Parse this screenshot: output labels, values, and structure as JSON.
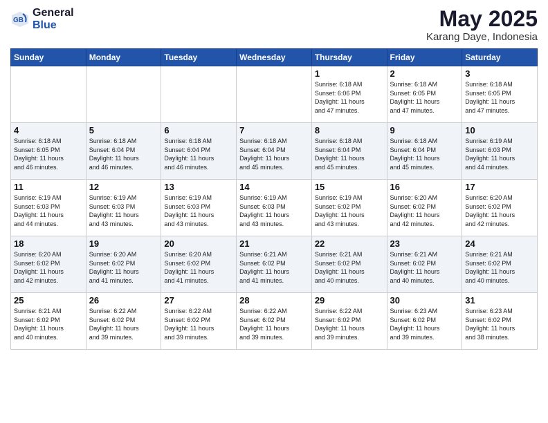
{
  "header": {
    "logo_general": "General",
    "logo_blue": "Blue",
    "month_year": "May 2025",
    "location": "Karang Daye, Indonesia"
  },
  "days_of_week": [
    "Sunday",
    "Monday",
    "Tuesday",
    "Wednesday",
    "Thursday",
    "Friday",
    "Saturday"
  ],
  "weeks": [
    [
      {
        "day": "",
        "content": ""
      },
      {
        "day": "",
        "content": ""
      },
      {
        "day": "",
        "content": ""
      },
      {
        "day": "",
        "content": ""
      },
      {
        "day": "1",
        "content": "Sunrise: 6:18 AM\nSunset: 6:06 PM\nDaylight: 11 hours\nand 47 minutes."
      },
      {
        "day": "2",
        "content": "Sunrise: 6:18 AM\nSunset: 6:05 PM\nDaylight: 11 hours\nand 47 minutes."
      },
      {
        "day": "3",
        "content": "Sunrise: 6:18 AM\nSunset: 6:05 PM\nDaylight: 11 hours\nand 47 minutes."
      }
    ],
    [
      {
        "day": "4",
        "content": "Sunrise: 6:18 AM\nSunset: 6:05 PM\nDaylight: 11 hours\nand 46 minutes."
      },
      {
        "day": "5",
        "content": "Sunrise: 6:18 AM\nSunset: 6:04 PM\nDaylight: 11 hours\nand 46 minutes."
      },
      {
        "day": "6",
        "content": "Sunrise: 6:18 AM\nSunset: 6:04 PM\nDaylight: 11 hours\nand 46 minutes."
      },
      {
        "day": "7",
        "content": "Sunrise: 6:18 AM\nSunset: 6:04 PM\nDaylight: 11 hours\nand 45 minutes."
      },
      {
        "day": "8",
        "content": "Sunrise: 6:18 AM\nSunset: 6:04 PM\nDaylight: 11 hours\nand 45 minutes."
      },
      {
        "day": "9",
        "content": "Sunrise: 6:18 AM\nSunset: 6:04 PM\nDaylight: 11 hours\nand 45 minutes."
      },
      {
        "day": "10",
        "content": "Sunrise: 6:19 AM\nSunset: 6:03 PM\nDaylight: 11 hours\nand 44 minutes."
      }
    ],
    [
      {
        "day": "11",
        "content": "Sunrise: 6:19 AM\nSunset: 6:03 PM\nDaylight: 11 hours\nand 44 minutes."
      },
      {
        "day": "12",
        "content": "Sunrise: 6:19 AM\nSunset: 6:03 PM\nDaylight: 11 hours\nand 43 minutes."
      },
      {
        "day": "13",
        "content": "Sunrise: 6:19 AM\nSunset: 6:03 PM\nDaylight: 11 hours\nand 43 minutes."
      },
      {
        "day": "14",
        "content": "Sunrise: 6:19 AM\nSunset: 6:03 PM\nDaylight: 11 hours\nand 43 minutes."
      },
      {
        "day": "15",
        "content": "Sunrise: 6:19 AM\nSunset: 6:02 PM\nDaylight: 11 hours\nand 43 minutes."
      },
      {
        "day": "16",
        "content": "Sunrise: 6:20 AM\nSunset: 6:02 PM\nDaylight: 11 hours\nand 42 minutes."
      },
      {
        "day": "17",
        "content": "Sunrise: 6:20 AM\nSunset: 6:02 PM\nDaylight: 11 hours\nand 42 minutes."
      }
    ],
    [
      {
        "day": "18",
        "content": "Sunrise: 6:20 AM\nSunset: 6:02 PM\nDaylight: 11 hours\nand 42 minutes."
      },
      {
        "day": "19",
        "content": "Sunrise: 6:20 AM\nSunset: 6:02 PM\nDaylight: 11 hours\nand 41 minutes."
      },
      {
        "day": "20",
        "content": "Sunrise: 6:20 AM\nSunset: 6:02 PM\nDaylight: 11 hours\nand 41 minutes."
      },
      {
        "day": "21",
        "content": "Sunrise: 6:21 AM\nSunset: 6:02 PM\nDaylight: 11 hours\nand 41 minutes."
      },
      {
        "day": "22",
        "content": "Sunrise: 6:21 AM\nSunset: 6:02 PM\nDaylight: 11 hours\nand 40 minutes."
      },
      {
        "day": "23",
        "content": "Sunrise: 6:21 AM\nSunset: 6:02 PM\nDaylight: 11 hours\nand 40 minutes."
      },
      {
        "day": "24",
        "content": "Sunrise: 6:21 AM\nSunset: 6:02 PM\nDaylight: 11 hours\nand 40 minutes."
      }
    ],
    [
      {
        "day": "25",
        "content": "Sunrise: 6:21 AM\nSunset: 6:02 PM\nDaylight: 11 hours\nand 40 minutes."
      },
      {
        "day": "26",
        "content": "Sunrise: 6:22 AM\nSunset: 6:02 PM\nDaylight: 11 hours\nand 39 minutes."
      },
      {
        "day": "27",
        "content": "Sunrise: 6:22 AM\nSunset: 6:02 PM\nDaylight: 11 hours\nand 39 minutes."
      },
      {
        "day": "28",
        "content": "Sunrise: 6:22 AM\nSunset: 6:02 PM\nDaylight: 11 hours\nand 39 minutes."
      },
      {
        "day": "29",
        "content": "Sunrise: 6:22 AM\nSunset: 6:02 PM\nDaylight: 11 hours\nand 39 minutes."
      },
      {
        "day": "30",
        "content": "Sunrise: 6:23 AM\nSunset: 6:02 PM\nDaylight: 11 hours\nand 39 minutes."
      },
      {
        "day": "31",
        "content": "Sunrise: 6:23 AM\nSunset: 6:02 PM\nDaylight: 11 hours\nand 38 minutes."
      }
    ]
  ]
}
